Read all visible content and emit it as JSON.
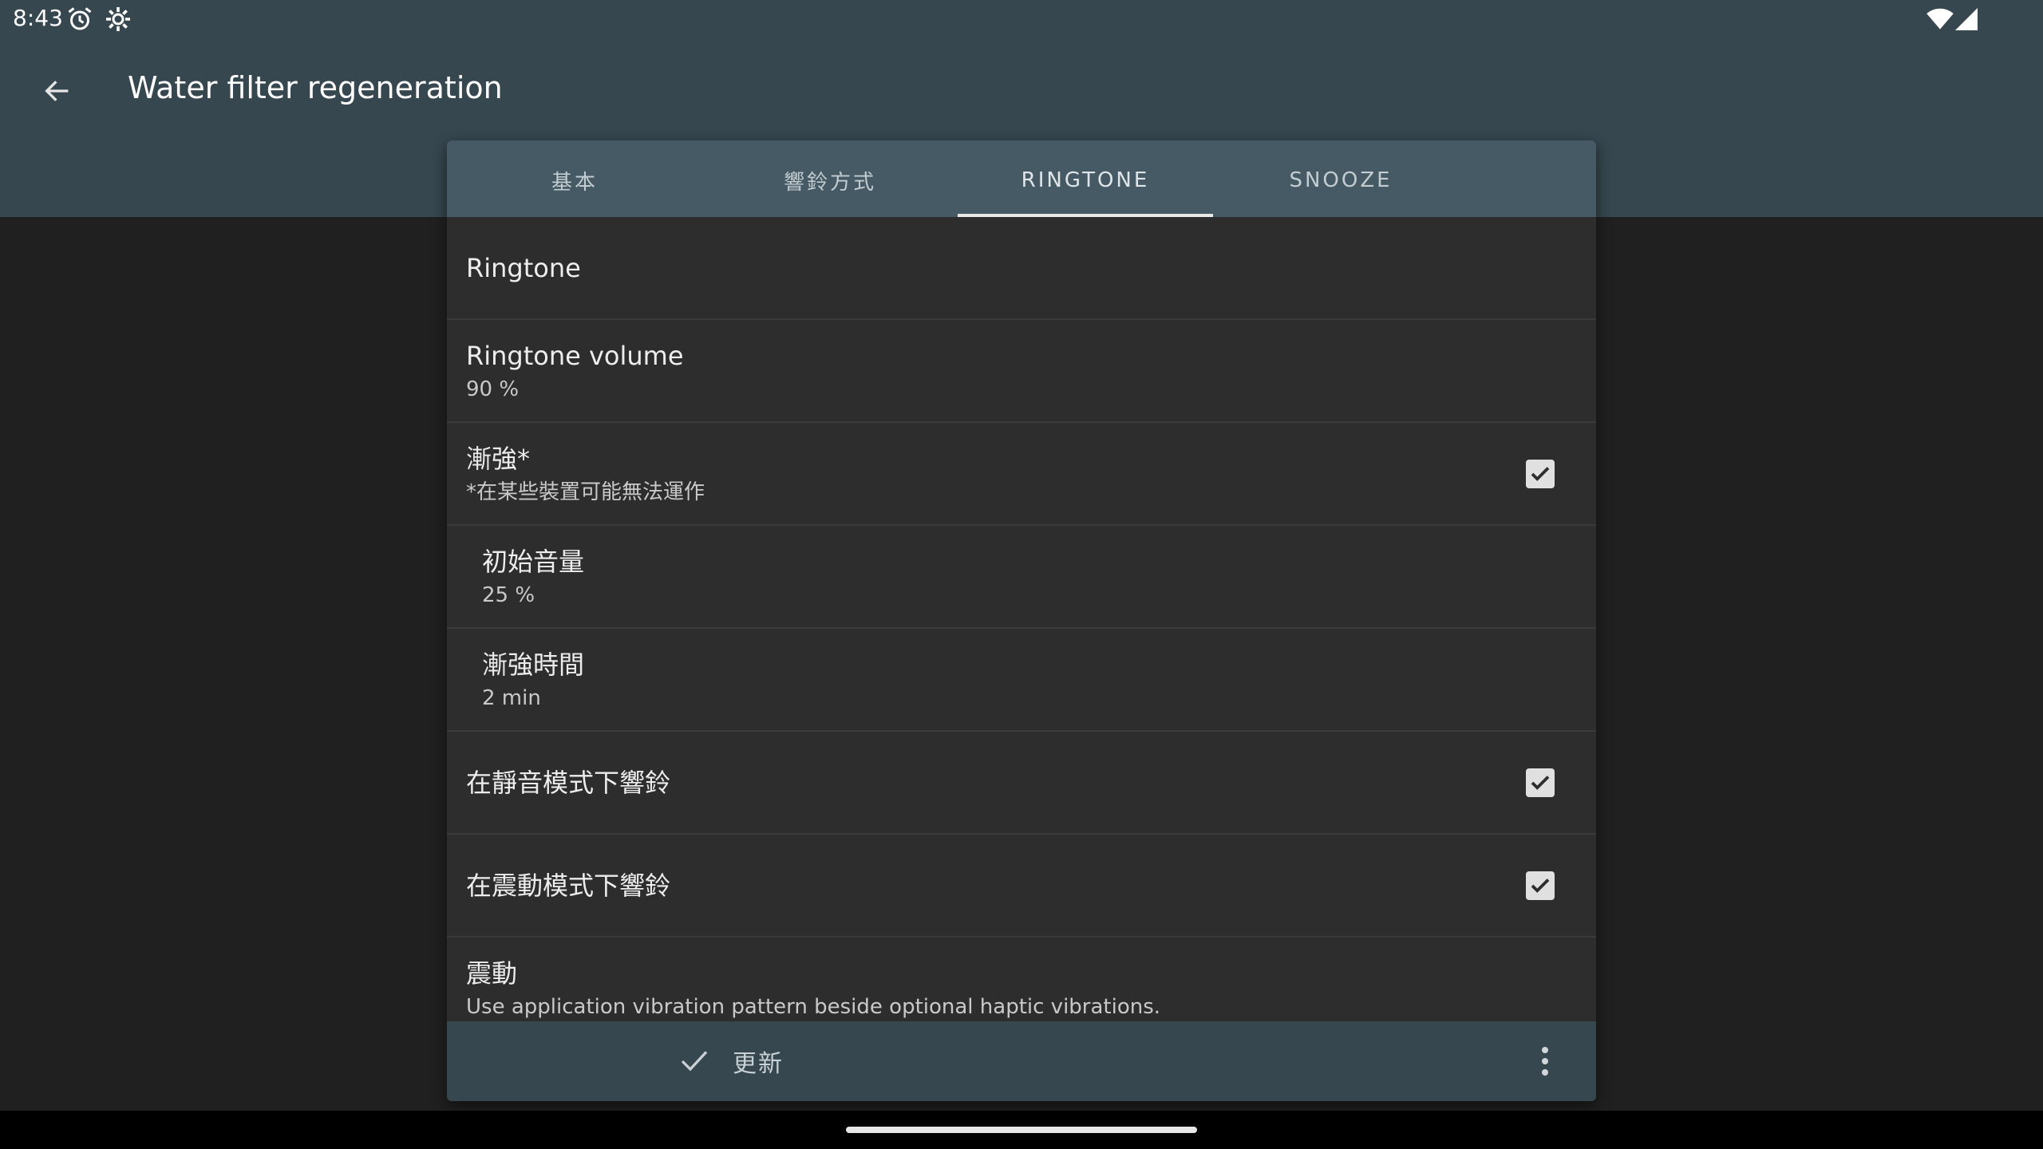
{
  "status_bar": {
    "time": "8:43",
    "icons": [
      "alarm-icon",
      "settings-icon",
      "wifi-icon",
      "signal-icon"
    ]
  },
  "header": {
    "title": "Water filter regeneration",
    "back_icon": "arrow-left-icon"
  },
  "tabs": [
    {
      "label": "基本",
      "active": false
    },
    {
      "label": "響鈴方式",
      "active": false
    },
    {
      "label": "RINGTONE",
      "active": true
    },
    {
      "label": "SNOOZE",
      "active": false
    }
  ],
  "settings": {
    "ringtone": {
      "title": "Ringtone"
    },
    "ringtone_volume": {
      "title": "Ringtone volume",
      "value": "90 %"
    },
    "crescendo": {
      "title": "漸強*",
      "subtitle": "*在某些裝置可能無法運作",
      "checked": true
    },
    "initial_volume": {
      "title": "初始音量",
      "value": "25 %"
    },
    "crescendo_time": {
      "title": "漸強時間",
      "value": "2 min"
    },
    "ring_in_silent": {
      "title": "在靜音模式下響鈴",
      "checked": true
    },
    "ring_in_vibrate": {
      "title": "在震動模式下響鈴",
      "checked": true
    },
    "vibration": {
      "title": "震動",
      "subtitle": "Use application vibration pattern beside optional haptic vibrations.",
      "checked": false
    }
  },
  "bottom_bar": {
    "update_label": "更新",
    "update_icon": "check-icon",
    "more_icon": "more-vert-icon"
  },
  "colors": {
    "appbar": "#36474f",
    "tabbar": "#455a64",
    "panel": "#2d2d2d",
    "background": "#202020"
  }
}
